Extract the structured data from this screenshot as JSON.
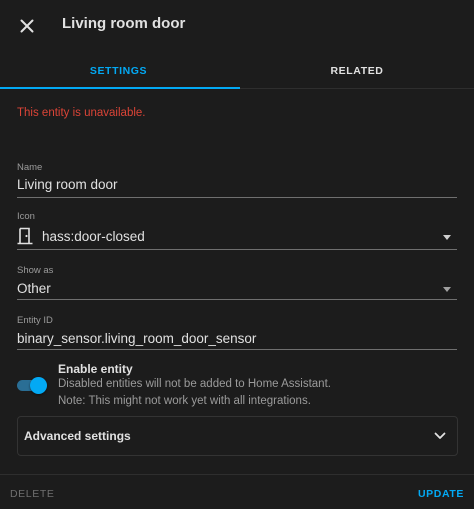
{
  "dialog": {
    "title": "Living room door",
    "close_icon": "close-icon"
  },
  "tabs": [
    {
      "label": "SETTINGS",
      "active": true
    },
    {
      "label": "RELATED",
      "active": false
    }
  ],
  "error_message": "This entity is unavailable.",
  "form": {
    "name": {
      "label": "Name",
      "value": "Living room door"
    },
    "icon": {
      "label": "Icon",
      "value": "hass:door-closed",
      "icon": "door-closed-icon"
    },
    "show_as": {
      "label": "Show as",
      "value": "Other"
    },
    "entity_id": {
      "label": "Entity ID",
      "value": "binary_sensor.living_room_door_sensor"
    }
  },
  "enable_entity": {
    "title": "Enable entity",
    "description_line1": "Disabled entities will not be added to Home Assistant.",
    "description_line2": "Note: This might not work yet with all integrations.",
    "enabled": true
  },
  "advanced": {
    "label": "Advanced settings"
  },
  "footer": {
    "delete_label": "DELETE",
    "update_label": "UPDATE"
  },
  "colors": {
    "accent": "#03a9f4",
    "error": "#db4437",
    "background": "#1c1c1c"
  }
}
